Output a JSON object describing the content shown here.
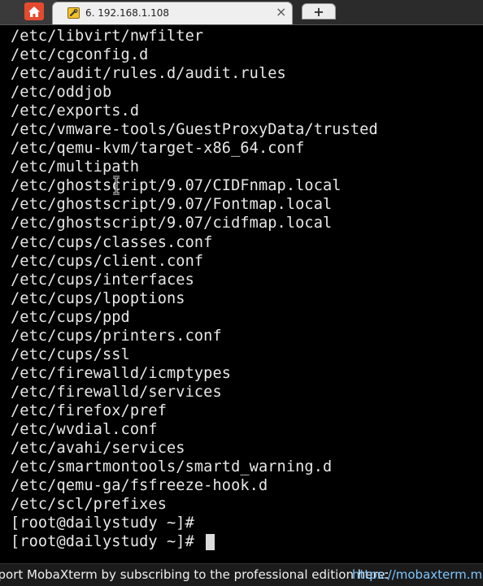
{
  "tabs": {
    "home_icon": "home-icon",
    "session": {
      "icon": "wrench-icon",
      "title": "6. 192.168.1.108",
      "close_label": "×"
    },
    "new_tab_label": "+"
  },
  "terminal": {
    "lines": [
      "/etc/libvirt/nwfilter",
      "/etc/cgconfig.d",
      "/etc/audit/rules.d/audit.rules",
      "/etc/oddjob",
      "/etc/exports.d",
      "/etc/vmware-tools/GuestProxyData/trusted",
      "/etc/qemu-kvm/target-x86_64.conf",
      "/etc/multipath",
      "/etc/ghostscript/9.07/CIDFnmap.local",
      "/etc/ghostscript/9.07/Fontmap.local",
      "/etc/ghostscript/9.07/cidfmap.local",
      "/etc/cups/classes.conf",
      "/etc/cups/client.conf",
      "/etc/cups/interfaces",
      "/etc/cups/lpoptions",
      "/etc/cups/ppd",
      "/etc/cups/printers.conf",
      "/etc/cups/ssl",
      "/etc/firewalld/icmptypes",
      "/etc/firewalld/services",
      "/etc/firefox/pref",
      "/etc/wvdial.conf",
      "/etc/avahi/services",
      "/etc/smartmontools/smartd_warning.d",
      "/etc/qemu-ga/fsfreeze-hook.d",
      "/etc/scl/prefixes",
      "[root@dailystudy ~]#"
    ],
    "prompt": "[root@dailystudy ~]# "
  },
  "statusbar": {
    "text": "pport MobaXterm by subscribing to the professional edition here:",
    "link": "https://mobaxterm.moba"
  },
  "colors": {
    "terminal_bg": "#000000",
    "terminal_fg": "#e8e8e8",
    "home_button": "#e64a2e",
    "link": "#7fc6ff"
  }
}
